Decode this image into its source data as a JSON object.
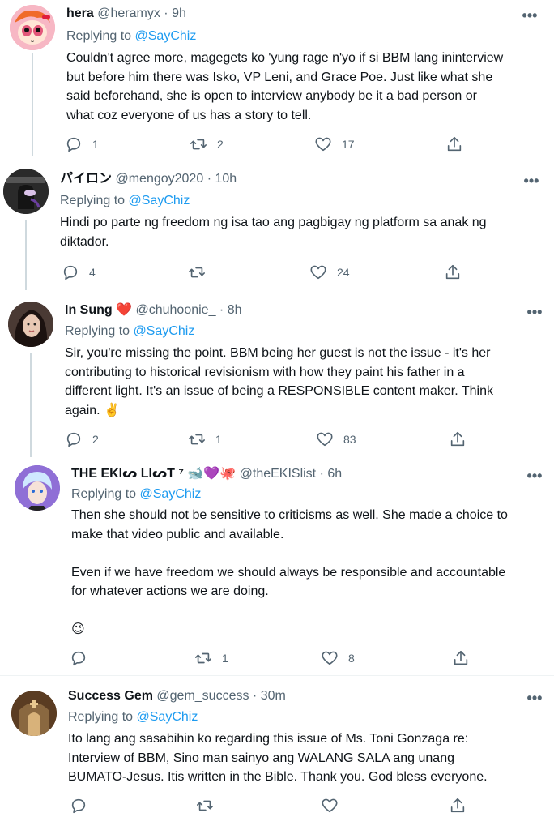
{
  "tweets": [
    {
      "name": "hera",
      "handle": "@heramyx",
      "time": "· 9h",
      "replying_prefix": "Replying to ",
      "replying_mention": "@SayChiz",
      "text": "Couldn't agree more, magegets ko 'yung rage n'yo if si BBM lang ininterview\nbut before him there was Isko, VP Leni, and Grace Poe. Just like what she\nsaid beforehand, she is open to interview anybody be it a bad person or\nwhat coz everyone of us has a story to tell.",
      "replies": "1",
      "retweets": "2",
      "likes": "17",
      "avatar_color": "#f4a6b6",
      "avatar_icon": "powerpuff-avatar"
    },
    {
      "name": "パイロン",
      "handle": "@mengoy2020",
      "time": "· 10h",
      "replying_prefix": "Replying to ",
      "replying_mention": "@SayChiz",
      "text": "Hindi po parte ng freedom ng isa tao ang pagbigay ng platform sa anak ng\ndiktador.",
      "replies": "4",
      "retweets": "",
      "likes": "24",
      "avatar_color": "#2b2b2b",
      "avatar_icon": "among-us-avatar"
    },
    {
      "name": "In Sung",
      "name_emoji": "❤️",
      "handle": "@chuhoonie_",
      "time": "· 8h",
      "replying_prefix": "Replying to ",
      "replying_mention": "@SayChiz",
      "text": "Sir, you're missing the point. BBM being her guest is not the issue - it's her\ncontributing to historical revisionism with how they paint his father in a\ndifferent light. It's an issue of being a RESPONSIBLE content maker. Think\nagain. ✌️",
      "replies": "2",
      "retweets": "1",
      "likes": "83",
      "avatar_color": "#3a2a26",
      "avatar_icon": "photo-avatar"
    },
    {
      "name": "THE EKIᔕ LIᔕT ⁷",
      "name_emoji": "🐋💜🐙",
      "handle": "@theEKISlist",
      "time": "· 6h",
      "replying_prefix": "Replying to ",
      "replying_mention": "@SayChiz",
      "text": "Then she should not be sensitive to criticisms as well. She made a choice to\nmake that video public and available.\n\nEven if we have freedom we should always be responsible and accountable\nfor whatever actions we are doing.\n\n😉",
      "replies": "",
      "retweets": "1",
      "likes": "8",
      "avatar_color": "#7a5cc8",
      "avatar_icon": "anime-avatar"
    },
    {
      "name": "Success Gem",
      "handle": "@gem_success",
      "time": "· 30m",
      "replying_prefix": "Replying to ",
      "replying_mention": "@SayChiz",
      "text": "Ito lang ang sasabihin ko regarding this issue of Ms. Toni Gonzaga re:\nInterview of BBM, Sino man sainyo ang WALANG SALA ang unang\nBUMATO-Jesus. Itis written in the Bible. Thank you. God bless everyone.",
      "replies": "",
      "retweets": "",
      "likes": "",
      "avatar_color": "#6b4a2c",
      "avatar_icon": "church-avatar"
    }
  ],
  "more_glyph": "•••"
}
